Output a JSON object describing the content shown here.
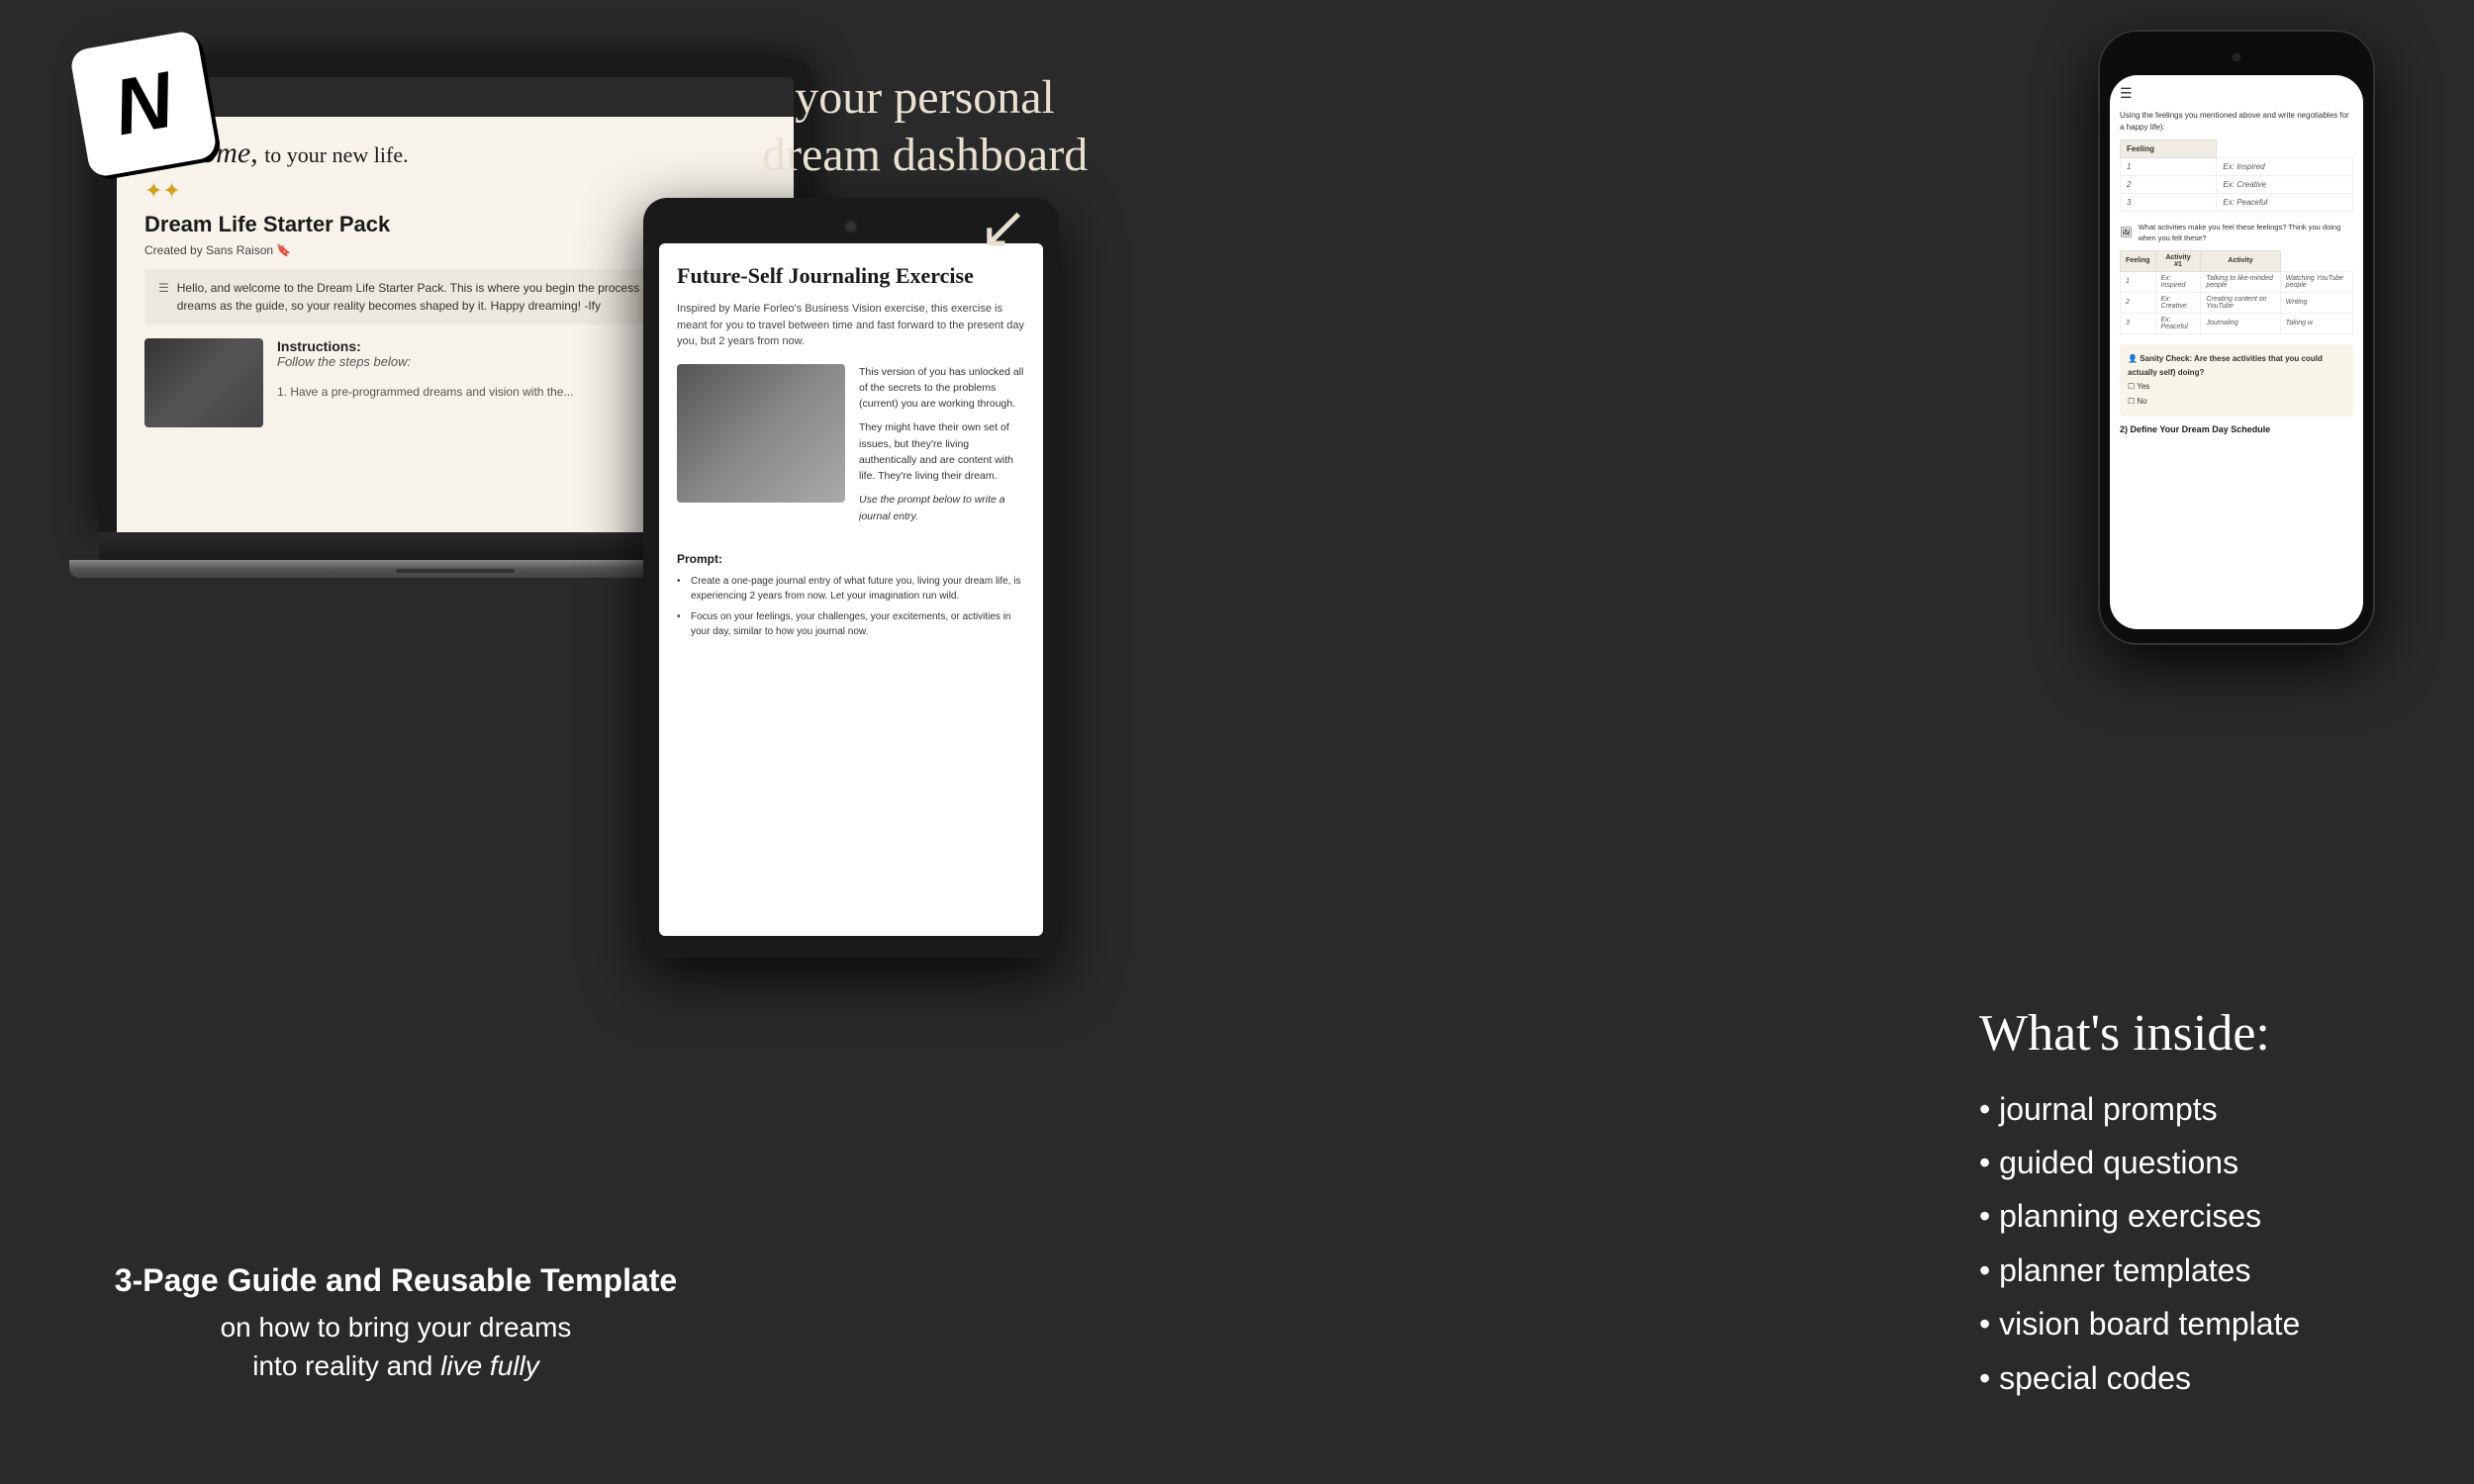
{
  "page": {
    "background_color": "#2a2a2a"
  },
  "notion_icon": {
    "letter": "N"
  },
  "dream_dashboard": {
    "line1": "your personal",
    "line2": "dream dashboard",
    "arrow": "↙"
  },
  "laptop": {
    "welcome_text": "Welcome, to your new life.",
    "sparkles": "✦✦",
    "title": "Dream Life Starter Pack",
    "created_by": "Created by Sans Raison",
    "body_text": "Hello, and welcome to the Dream Life Starter Pack. This is where you begin the process of using your dreams as the guide, so your reality becomes shaped by it. Happy dreaming! -Ify",
    "instructions_title": "Instructions:",
    "instructions_sub": "Follow the steps below:"
  },
  "bottom_text": {
    "bold": "3-Page Guide and Reusable Template",
    "line1": "on how to bring your dreams",
    "line2": "into reality and",
    "italic": "live fully"
  },
  "tablet": {
    "title": "Future-Self Journaling Exercise",
    "subtitle": "Inspired by Marie Forleo's Business Vision exercise, this exercise is meant for you to travel between time and fast forward to the present day you, but 2 years from now.",
    "paragraph1": "This version of you has unlocked all of the secrets to the problems (current) you are working through.",
    "paragraph2": "They might have their own set of issues, but they're living authentically and are content with life. They're living their dream.",
    "italic_line": "Use the prompt below to write a journal entry.",
    "prompt_title": "Prompt:",
    "bullet1": "Create a one-page journal entry of what future you, living your dream life, is experiencing 2 years from now. Let your imagination run wild.",
    "bullet2": "Focus on your feelings, your challenges, your excitements, or activities in your day, similar to how you journal now."
  },
  "phone": {
    "header_text": "Using the feelings you mentioned above and write negotiables for a happy life):",
    "table1": {
      "header": "Feeling",
      "rows": [
        "Ex: Inspired",
        "Ex: Creative",
        "Ex: Peaceful"
      ]
    },
    "question": "What activities make you feel these feelings? Think you doing when you felt these?",
    "table2": {
      "headers": [
        "Feeling",
        "Activity #1",
        "Activity"
      ],
      "rows": [
        [
          "Ex: Inspired",
          "Talking to like-minded people",
          "Watching YouTube people"
        ],
        [
          "Ex: Creative",
          "Creating content on YouTube",
          "Writing"
        ],
        [
          "Ex: Peaceful",
          "Journaling",
          "Taking w"
        ]
      ]
    },
    "sanity_check": "Sanity Check: Are these activities that you could actually self) doing?",
    "yes": "Yes",
    "no": "No",
    "define": "2) Define Your Dream Day Schedule"
  },
  "whats_inside": {
    "title": "What's inside:",
    "items": [
      "journal prompts",
      "guided questions",
      "planning exercises",
      "planner templates",
      "vision board template",
      "special codes"
    ]
  }
}
